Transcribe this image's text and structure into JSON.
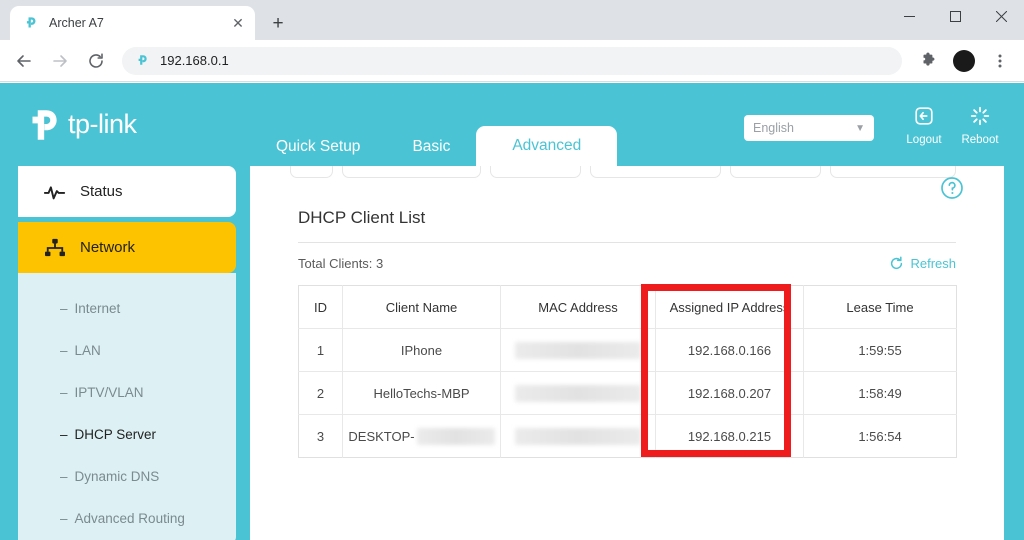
{
  "browser": {
    "tab": {
      "title": "Archer A7",
      "favicon_icon": "tplink-favicon",
      "close_icon": "close-icon"
    },
    "new_tab_icon": "plus-icon",
    "window_controls": {
      "minimize_icon": "minimize-icon",
      "maximize_icon": "maximize-icon",
      "close_icon": "window-close-icon"
    },
    "nav": {
      "back_icon": "arrow-left-icon",
      "forward_icon": "arrow-right-icon",
      "reload_icon": "reload-icon"
    },
    "omnibox": {
      "url": "192.168.0.1",
      "favicon_icon": "tplink-favicon"
    },
    "toolbar_icons": {
      "extensions_icon": "puzzle-icon",
      "profile_icon": "avatar-icon",
      "menu_icon": "kebab-menu-icon"
    }
  },
  "router": {
    "brand": {
      "name": "tp-link",
      "logo_icon": "tplink-logo-icon"
    },
    "nav_tabs": [
      {
        "label": "Quick Setup",
        "active": false
      },
      {
        "label": "Basic",
        "active": false
      },
      {
        "label": "Advanced",
        "active": true
      }
    ],
    "language": {
      "value": "English",
      "caret_icon": "chevron-down-icon"
    },
    "logout": {
      "label": "Logout",
      "icon": "logout-icon"
    },
    "reboot": {
      "label": "Reboot",
      "icon": "reboot-icon"
    },
    "sidebar": {
      "main_items": [
        {
          "label": "Status",
          "icon": "pulse-icon",
          "state": "white"
        },
        {
          "label": "Network",
          "icon": "network-tree-icon",
          "state": "amber"
        }
      ],
      "sub_items": [
        {
          "label": "Internet",
          "active": false
        },
        {
          "label": "LAN",
          "active": false
        },
        {
          "label": "IPTV/VLAN",
          "active": false
        },
        {
          "label": "DHCP Server",
          "active": true
        },
        {
          "label": "Dynamic DNS",
          "active": false
        },
        {
          "label": "Advanced Routing",
          "active": false
        }
      ],
      "dash": "–"
    },
    "content": {
      "help_icon": "help-circle-icon",
      "panel_title": "DHCP Client List",
      "total_clients": "Total Clients: 3",
      "refresh": {
        "label": "Refresh",
        "icon": "refresh-icon"
      },
      "table": {
        "columns": [
          "ID",
          "Client Name",
          "MAC Address",
          "Assigned IP Address",
          "Lease Time"
        ],
        "rows": [
          {
            "id": "1",
            "client_name": "IPhone",
            "name_redacted": false,
            "mac_address": "",
            "mac_redacted": true,
            "assigned_ip": "192.168.0.166",
            "lease_time": "1:59:55"
          },
          {
            "id": "2",
            "client_name": "HelloTechs-MBP",
            "name_redacted": false,
            "mac_address": "",
            "mac_redacted": true,
            "assigned_ip": "192.168.0.207",
            "lease_time": "1:58:49"
          },
          {
            "id": "3",
            "client_name": "DESKTOP-",
            "name_redacted": true,
            "mac_address": "",
            "mac_redacted": true,
            "assigned_ip": "192.168.0.215",
            "lease_time": "1:56:54"
          }
        ]
      },
      "annotation": {
        "type": "highlight-box",
        "target_column": "Assigned IP Address",
        "color": "#ee1c1c"
      }
    },
    "colors": {
      "brand_teal": "#4ac4d4",
      "menu_amber": "#fdc300",
      "submenu_bg": "#ddf1f4",
      "annotation_red": "#ee1c1c"
    }
  }
}
